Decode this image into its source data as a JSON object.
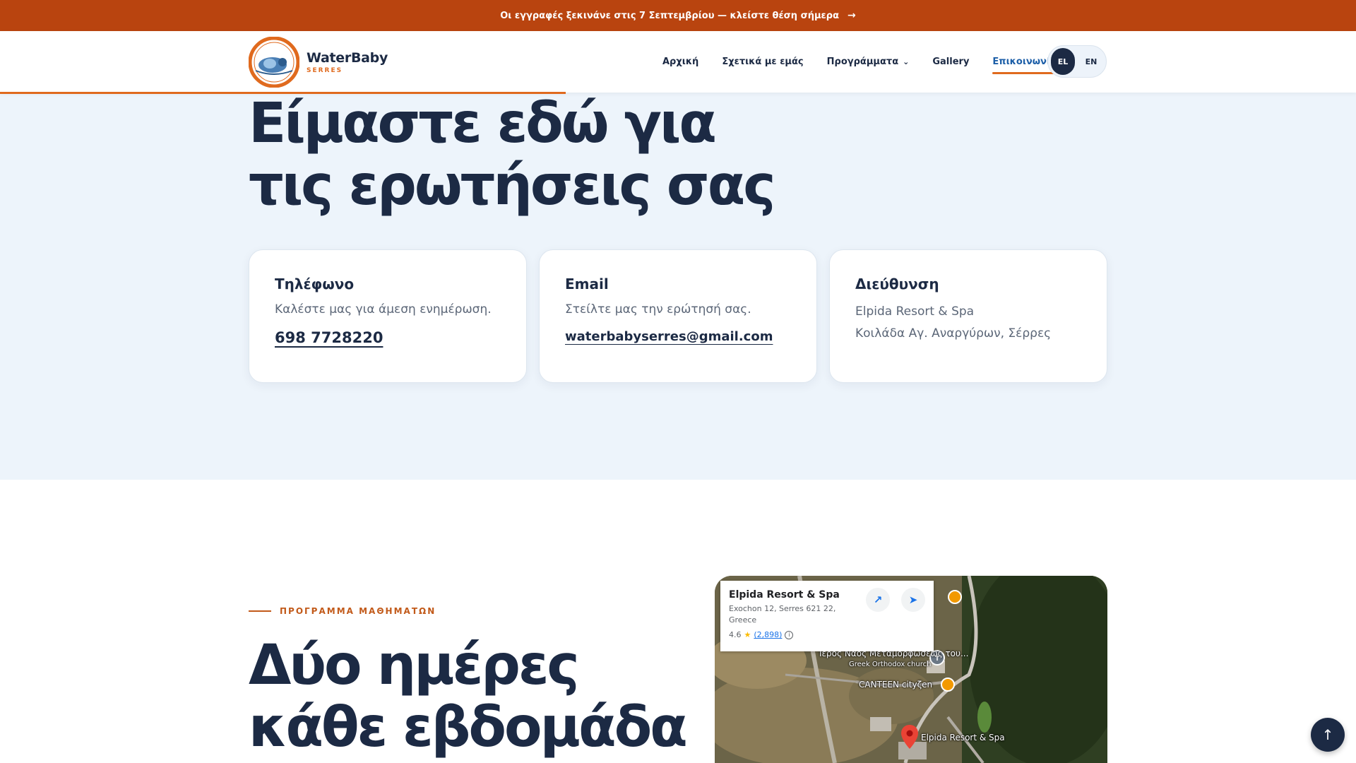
{
  "announcement": {
    "text": "Οι εγγραφές ξεκινάνε στις 7 Σεπτεμβρίου — κλείστε θέση σήμερα",
    "arrow_icon": "arrow-right-icon"
  },
  "header": {
    "logo": {
      "name": "WaterBaby",
      "sub": "SERRES",
      "mark_text": "WaterBaby",
      "mark_sub": "SERRES"
    },
    "nav": [
      {
        "label": "Αρχική"
      },
      {
        "label": "Σχετικά με εμάς"
      },
      {
        "label": "Προγράμματα"
      },
      {
        "label": "Gallery"
      },
      {
        "label": "Επικοινωνία",
        "active": true
      }
    ],
    "lang": {
      "el": "EL",
      "en": "EN",
      "selected": "EL"
    }
  },
  "hero": {
    "title_line1": "Είμαστε εδώ για",
    "title_line2": "τις ερωτήσεις σας",
    "cards": {
      "phone": {
        "title": "Τηλέφωνο",
        "desc": "Καλέστε μας για άμεση ενημέρωση.",
        "link": "698 7728220"
      },
      "email": {
        "title": "Email",
        "desc": "Στείλτε μας την ερώτησή σας.",
        "link": "waterbabyserres@gmail.com"
      },
      "address": {
        "title": "Διεύθυνση",
        "line1": "Elpida Resort & Spa",
        "line2": "Κοιλάδα Αγ. Αναργύρων, Σέρρες"
      }
    }
  },
  "schedule": {
    "eyebrow": "ΠΡΟΓΡΑΜΜΑ ΜΑΘΗΜΑΤΩΝ",
    "title_line1": "Δύο ημέρες",
    "title_line2": "κάθε εβδομάδα"
  },
  "map": {
    "place_name": "Elpida Resort & Spa",
    "address": "Exochon 12, Serres 621 22, Greece",
    "rating": "4.6",
    "reviews": "(2,898)",
    "labels": {
      "church": "Ιερός Ναός Μεταμορφώσεως του...",
      "church_type": "Greek Orthodox church",
      "canteen": "CANTEEN cityζen",
      "pin": "Elpida Resort & Spa"
    }
  },
  "colors": {
    "accent": "#b9440f",
    "navy": "#1c2a44",
    "link_active": "#1d5fa8",
    "hero_bg": "#edf4fb"
  }
}
